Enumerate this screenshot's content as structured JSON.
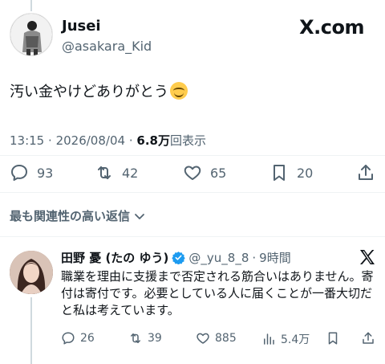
{
  "post": {
    "author_name": "Jusei",
    "author_handle": "@asakara_Kid",
    "site_logo": "X.com",
    "text": "汚い金やけどありがとう",
    "emoji_icon": "smiling-face-emoji",
    "time": "13:15",
    "date": "2026/08/04",
    "separator": "·",
    "views_count": "6.8万",
    "views_label": "回表示",
    "actions": {
      "replies": "93",
      "reposts": "42",
      "likes": "65",
      "bookmarks": "20"
    }
  },
  "sort_label": "最も関連性の高い返信",
  "reply": {
    "name": "田野 憂 (たの ゆう)",
    "handle": "@_yu_8_8",
    "separator": "·",
    "time_ago": "9時間",
    "text": "職業を理由に支援まで否定される筋合いはありません。寄付は寄付です。必要としている人に届くことが一番大切だと私は考えています。",
    "actions": {
      "replies": "26",
      "reposts": "39",
      "likes": "885",
      "views": "5.4万"
    }
  },
  "colors": {
    "text": "#0f1419",
    "secondary": "#536471",
    "verified": "#1d9bf0",
    "divider": "#eff3f4"
  }
}
